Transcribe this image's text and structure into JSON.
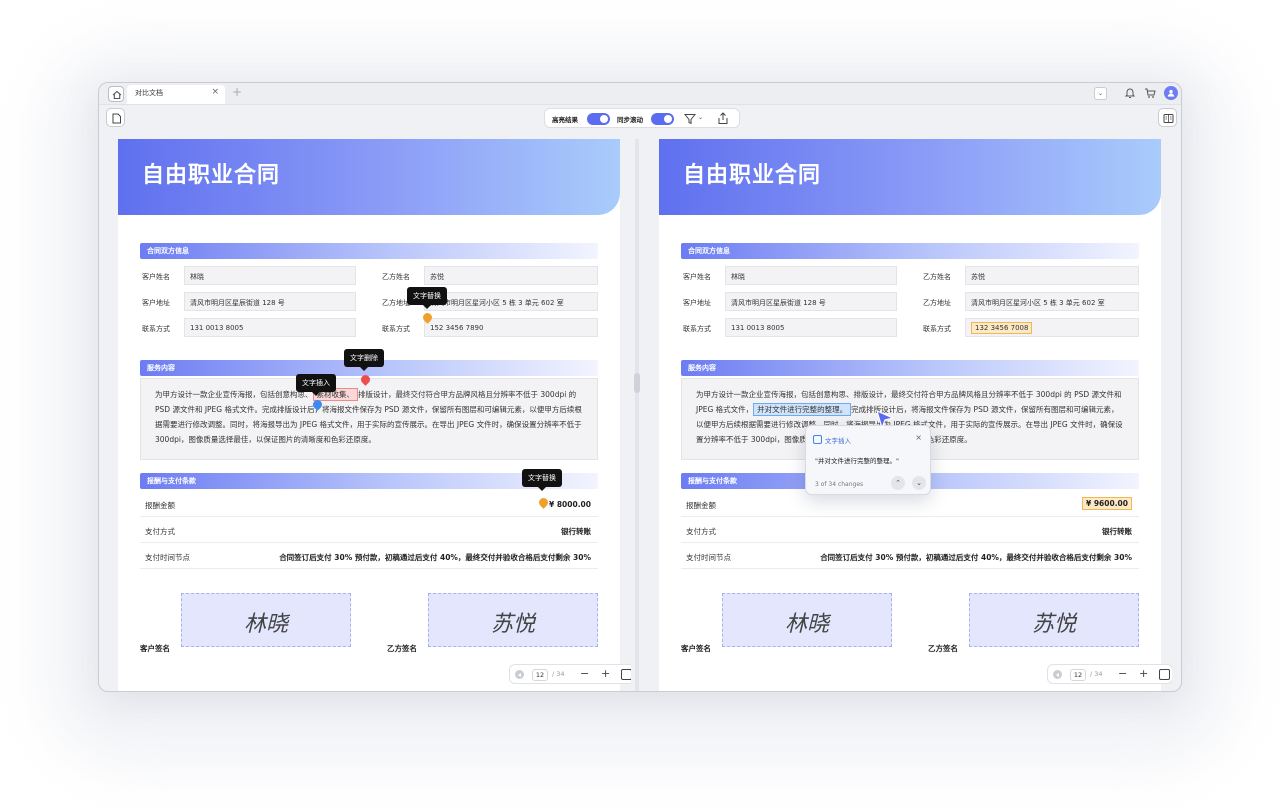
{
  "window": {
    "tab_title": "对比文档",
    "tab_close": "×",
    "tab_add": "+",
    "chevron": "⌄"
  },
  "toolbar": {
    "highlight_label": "高亮结果",
    "sync_scroll_label": "同步滚动",
    "filter_chevron": "⌄"
  },
  "document": {
    "title": "自由职业合同",
    "section_parties": "合同双方信息",
    "section_service": "服务内容",
    "section_payment": "报酬与支付条款",
    "labels": {
      "client_name": "客户姓名",
      "client_address": "客户地址",
      "client_phone": "联系方式",
      "party_b_name": "乙方姓名",
      "party_b_address": "乙方地址",
      "party_b_phone": "联系方式",
      "pay_amount": "报酬金额",
      "pay_method": "支付方式",
      "pay_schedule": "支付时间节点",
      "client_sign": "客户签名",
      "party_b_sign": "乙方签名"
    },
    "signatures": {
      "client": "林晓",
      "party_b": "苏悦"
    }
  },
  "left": {
    "client_name": "林晓",
    "client_address": "清风市明月区星辰街道 128 号",
    "client_phone": "131 0013 8005",
    "party_b_name": "苏悦",
    "party_b_address": "清风市明月区星河小区 5 栋 3 单元 602 室",
    "party_b_phone": "152 3456 7890",
    "service_a": "为甲方设计一款企业宣传海报，包括创意构思、",
    "service_deleted": "素材收集、",
    "service_b": "排版设计，最终交付符合甲方品牌风格且分辨率不低于 300dpi 的 PSD 源文件和 JPEG 格式文件。完成排版设计后，将海报文件保存为 PSD 源文件，保留所有图层和可编辑元素，以便甲方后续根据需要进行修改调整。同时，将海报导出为 JPEG 格式文件，用于实际的宣传展示。在导出 JPEG 文件时，确保设置分辨率不低于 300dpi，图像质量选择最佳，以保证图片的清晰度和色彩还原度。",
    "pay_amount": "¥ 8000.00",
    "pay_method": "银行转账",
    "pay_schedule": "合同签订后支付 30% 预付款，初稿通过后支付 40%，最终交付并验收合格后支付剩余 30%",
    "page_current": "12",
    "page_total": "/ 34"
  },
  "right": {
    "client_name": "林晓",
    "client_address": "清风市明月区星辰街道 128 号",
    "client_phone": "131 0013 8005",
    "party_b_name": "苏悦",
    "party_b_address": "清风市明月区星河小区 5 栋 3 单元 602 室",
    "party_b_phone": "132 3456 7008",
    "service_a": "为甲方设计一款企业宣传海报，包括创意构思、排版设计，最终交付符合甲方品牌风格且分辨率不低于 300dpi 的 PSD 源文件和 JPEG 格式文件，",
    "service_inserted": "并对文件进行完整的整理。",
    "service_b": "完成排版设计后，将海报文件保存为 PSD 源文件，保留所有图层和可编辑元素，以便甲方后续根据需要进行修改调整。同时，将海报导出为 JPEG 格式文件，用于实际的宣传展示。在导出 JPEG 文件时，确保设置分辨率不低于 300dpi，图像质量选择最佳，以保证图片的清晰度和色彩还原度。",
    "pay_amount": "¥ 9600.00",
    "pay_method": "银行转账",
    "pay_schedule": "合同签订后支付 30% 预付款，初稿通过后支付 40%，最终交付并验收合格后支付剩余 30%",
    "page_current": "12",
    "page_total": "/ 34"
  },
  "annotations": {
    "text_insert": "文字插入",
    "text_delete": "文字删除",
    "text_replace": "文字替换"
  },
  "popup": {
    "title": "文字插入",
    "close": "×",
    "body": "\"并对文件进行完整的整理。\"",
    "count": "3 of 34 changes",
    "prev": "⌃",
    "next": "⌄"
  },
  "zoom": {
    "minus": "−",
    "plus": "+"
  },
  "colors": {
    "accent": "#5b6cf0",
    "insert_highlight": "#cfe3fb",
    "delete_highlight": "#fbd8d8",
    "replace_highlight": "#fde9c4"
  }
}
